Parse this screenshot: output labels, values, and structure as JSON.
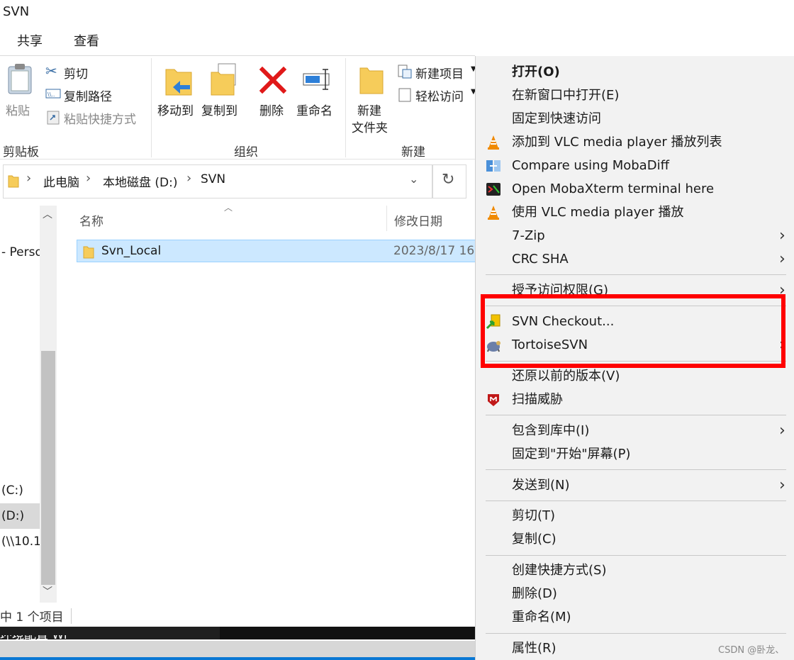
{
  "window": {
    "title": "SVN"
  },
  "ribbon": {
    "tabs": [
      "共享",
      "查看"
    ],
    "clipboard": {
      "paste": "粘贴",
      "cut": "剪切",
      "copy_path": "复制路径",
      "paste_shortcut": "粘贴快捷方式",
      "group": "剪贴板"
    },
    "organize": {
      "move_to": "移动到",
      "copy_to": "复制到",
      "delete": "删除",
      "rename": "重命名",
      "group": "组织"
    },
    "new": {
      "new_folder_1": "新建",
      "new_folder_2": "文件夹",
      "new_item": "新建项目",
      "easy_access": "轻松访问",
      "group": "新建"
    }
  },
  "address": {
    "crumbs": [
      "此电脑",
      "本地磁盘 (D:)",
      "SVN"
    ]
  },
  "nav": {
    "items": [
      "- Perso",
      "(C:)",
      "(D:)",
      "(\\\\10.1"
    ]
  },
  "files": {
    "col_name": "名称",
    "col_date": "修改日期",
    "rows": [
      {
        "name": "Svn_Local",
        "date": "2023/8/17 16"
      }
    ]
  },
  "status": "中 1 个项目",
  "taskbar_text": "环境配置 Wi",
  "menu": {
    "items": [
      "打开(O)",
      "在新窗口中打开(E)",
      "固定到快速访问",
      "添加到 VLC media player 播放列表",
      "Compare using MobaDiff",
      "Open MobaXterm terminal here",
      "使用 VLC media player 播放",
      "7-Zip",
      "CRC SHA",
      "授予访问权限(G)",
      "SVN Checkout...",
      "TortoiseSVN",
      "还原以前的版本(V)",
      "扫描威胁",
      "包含到库中(I)",
      "固定到\"开始\"屏幕(P)",
      "发送到(N)",
      "剪切(T)",
      "复制(C)",
      "创建快捷方式(S)",
      "删除(D)",
      "重命名(M)",
      "属性(R)"
    ]
  },
  "watermark": "CSDN @卧龙、",
  "colors": {
    "highlight_box": "#ff0000",
    "selection": "#cce8ff",
    "menu_bg": "#f2f2f2"
  }
}
